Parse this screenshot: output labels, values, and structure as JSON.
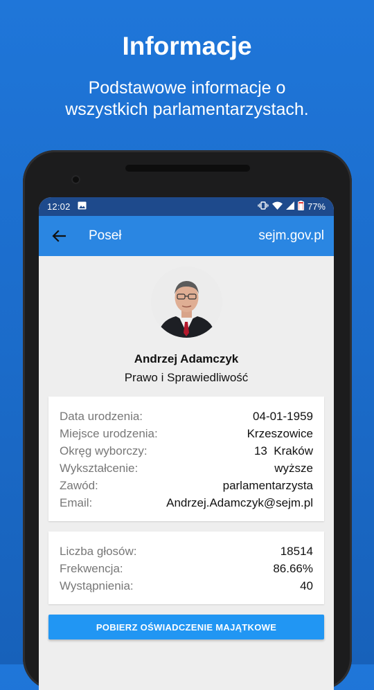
{
  "promo": {
    "title": "Informacje",
    "subtitle_line1": "Podstawowe informacje o",
    "subtitle_line2": "wszystkich parlamentarzystach."
  },
  "statusbar": {
    "time": "12:02",
    "battery": "77%",
    "icons": [
      "image-icon",
      "vibrate-icon",
      "wifi-icon",
      "signal-icon",
      "battery-icon"
    ]
  },
  "appbar": {
    "back_icon": "arrow-left-icon",
    "title": "Poseł",
    "site": "sejm.gov.pl",
    "color": "#2a86e2"
  },
  "profile": {
    "name": "Andrzej Adamczyk",
    "party": "Prawo i Sprawiedliwość"
  },
  "details": [
    {
      "label": "Data urodzenia:",
      "value": "04-01-1959"
    },
    {
      "label": "Miejsce urodzenia:",
      "value": "Krzeszowice"
    },
    {
      "label": "Okręg wyborczy:",
      "value": "13  Kraków"
    },
    {
      "label": "Wykształcenie:",
      "value": "wyższe"
    },
    {
      "label": "Zawód:",
      "value": "parlamentarzysta"
    },
    {
      "label": "Email:",
      "value": "Andrzej.Adamczyk@sejm.pl"
    }
  ],
  "stats": [
    {
      "label": "Liczba głosów:",
      "value": "18514"
    },
    {
      "label": "Frekwencja:",
      "value": "86.66%"
    },
    {
      "label": "Wystąpnienia:",
      "value": "40"
    }
  ],
  "download_button": "POBIERZ OŚWIADCZENIE MAJĄTKOWE"
}
